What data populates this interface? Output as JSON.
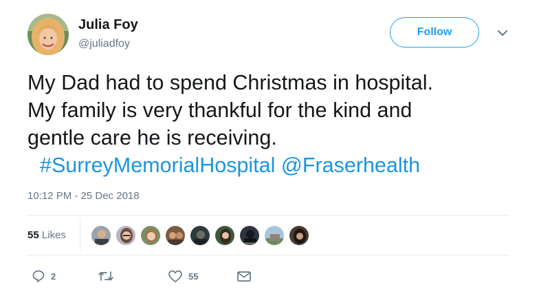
{
  "user": {
    "display_name": "Julia Foy",
    "handle": "@juliadfoy",
    "follow_label": "Follow"
  },
  "tweet": {
    "lines": [
      "My Dad had to spend Christmas in hospital.",
      "My family is very thankful for the kind and",
      "gentle care he is receiving."
    ],
    "hashtag": "#SurreyMemorialHospital",
    "mention": "@Fraserhealth",
    "timestamp": "10:12 PM - 25 Dec 2018"
  },
  "stats": {
    "likes_count": "55",
    "likes_label": "Likes"
  },
  "actions": {
    "reply_count": "2",
    "retweet_count": "",
    "like_count": "55"
  },
  "icons": [
    "chevron-down-icon",
    "reply-icon",
    "retweet-icon",
    "heart-icon",
    "envelope-icon"
  ],
  "colors": {
    "accent": "#1da1f2",
    "link": "#1b95e0",
    "secondary_text": "#657786",
    "divider": "#e6ecf0"
  }
}
